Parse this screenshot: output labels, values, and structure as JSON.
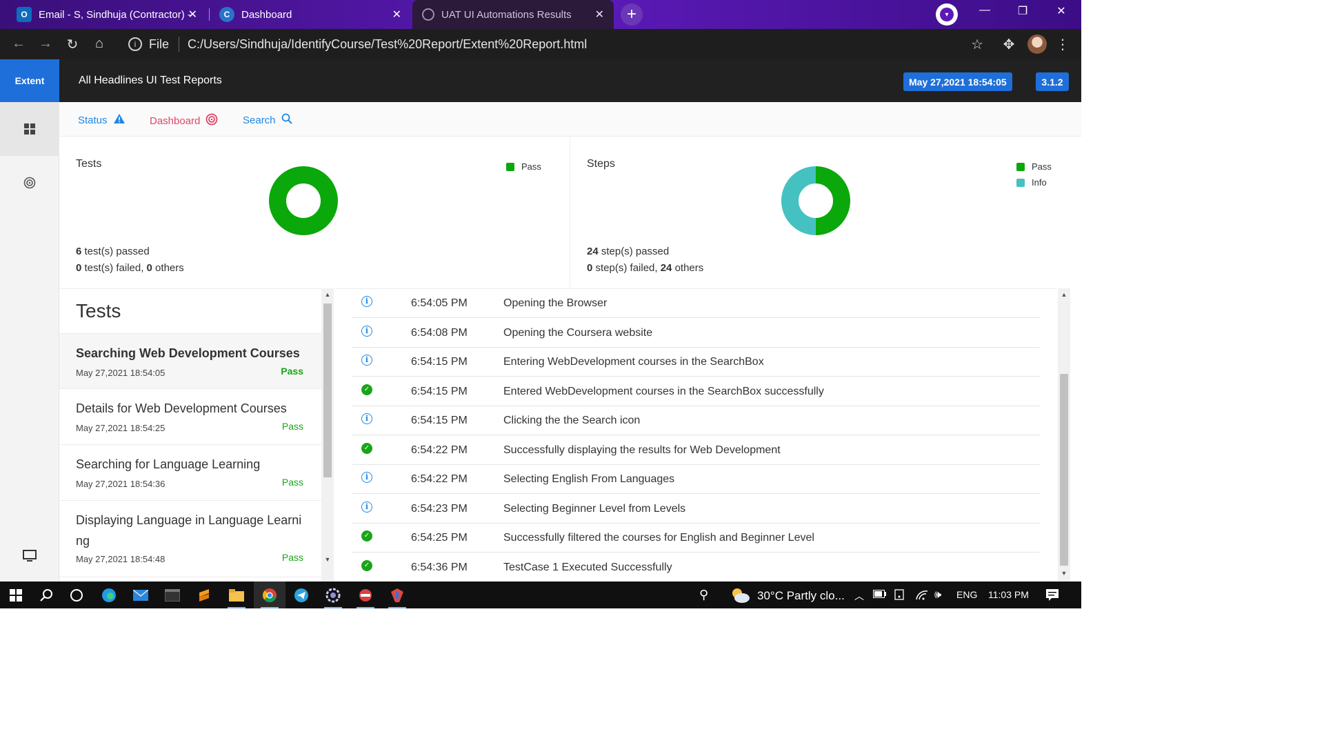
{
  "browser": {
    "tabs": [
      {
        "label": "Email - S, Sindhuja (Contractor) -",
        "icon": "outlook-icon"
      },
      {
        "label": "Dashboard",
        "icon": "coursera-icon"
      },
      {
        "label": "UAT UI Automations Results",
        "icon": "globe-icon"
      }
    ],
    "address": {
      "scheme_label": "File",
      "url": "C:/Users/Sindhuja/IdentifyCourse/Test%20Report/Extent%20Report.html"
    }
  },
  "header": {
    "logo": "Extent",
    "title": "All Headlines UI Test Reports",
    "date_badge": "May 27,2021 18:54:05",
    "version_badge": "3.1.2"
  },
  "nav": {
    "status": "Status",
    "dashboard": "Dashboard",
    "search": "Search"
  },
  "tests_card": {
    "title": "Tests",
    "legend": [
      {
        "label": "Pass",
        "color": "#0aa80a"
      }
    ],
    "passed_count": "6",
    "passed_text": " test(s) passed",
    "failed_count": "0",
    "failed_text": " test(s) failed, ",
    "others_count": "0",
    "others_text": " others",
    "chart": {
      "pass": 6,
      "info": 0
    }
  },
  "steps_card": {
    "title": "Steps",
    "legend": [
      {
        "label": "Pass",
        "color": "#0aa80a"
      },
      {
        "label": "Info",
        "color": "#45c1c1"
      }
    ],
    "passed_count": "24",
    "passed_text": " step(s) passed",
    "failed_count": "0",
    "failed_text": " step(s) failed, ",
    "others_count": "24",
    "others_text": " others",
    "chart": {
      "pass": 24,
      "info": 24
    }
  },
  "tests_list": {
    "heading": "Tests",
    "items": [
      {
        "name": "Searching Web Development Courses",
        "date": "May 27,2021 18:54:05",
        "status": "Pass"
      },
      {
        "name": "Details for Web Development Courses",
        "date": "May 27,2021 18:54:25",
        "status": "Pass"
      },
      {
        "name": "Searching for Language Learning",
        "date": "May 27,2021 18:54:36",
        "status": "Pass"
      },
      {
        "name": "Displaying Language in Language Learning",
        "date": "May 27,2021 18:54:48",
        "status": "Pass"
      }
    ]
  },
  "steps": [
    {
      "type": "info",
      "time": "6:54:05 PM",
      "detail": "Opening the Browser"
    },
    {
      "type": "info",
      "time": "6:54:08 PM",
      "detail": "Opening the Coursera website"
    },
    {
      "type": "info",
      "time": "6:54:15 PM",
      "detail": "Entering WebDevelopment courses in the SearchBox"
    },
    {
      "type": "pass",
      "time": "6:54:15 PM",
      "detail": "Entered WebDevelopment courses in the SearchBox successfully"
    },
    {
      "type": "info",
      "time": "6:54:15 PM",
      "detail": "Clicking the the Search icon"
    },
    {
      "type": "pass",
      "time": "6:54:22 PM",
      "detail": "Successfully displaying the results for Web Development"
    },
    {
      "type": "info",
      "time": "6:54:22 PM",
      "detail": "Selecting English From Languages"
    },
    {
      "type": "info",
      "time": "6:54:23 PM",
      "detail": "Selecting Beginner Level from Levels"
    },
    {
      "type": "pass",
      "time": "6:54:25 PM",
      "detail": "Successfully filtered the courses for English and Beginner Level"
    },
    {
      "type": "pass",
      "time": "6:54:36 PM",
      "detail": "TestCase 1 Executed Successfully"
    }
  ],
  "taskbar": {
    "weather": "30°C  Partly clo...",
    "language": "ENG",
    "clock": "11:03 PM"
  },
  "colors": {
    "accent": "#1e6fd9",
    "pass": "#0aa80a",
    "info": "#45c1c1"
  }
}
